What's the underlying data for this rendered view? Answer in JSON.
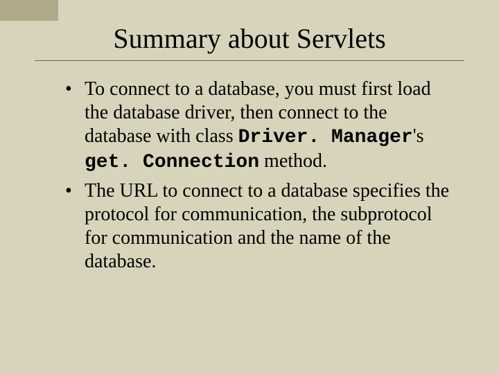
{
  "title": "Summary about Servlets",
  "bullets": [
    {
      "pre": "To connect to a database, you must first load the database driver, then connect to the database with class ",
      "code1": "Driver. Manager",
      "mid": "'s ",
      "code2": "get. Connection",
      "post": " method."
    },
    {
      "pre": "The URL to connect to a database specifies the protocol for communication, the subprotocol for communication and the name of the database.",
      "code1": "",
      "mid": "",
      "code2": "",
      "post": ""
    }
  ]
}
